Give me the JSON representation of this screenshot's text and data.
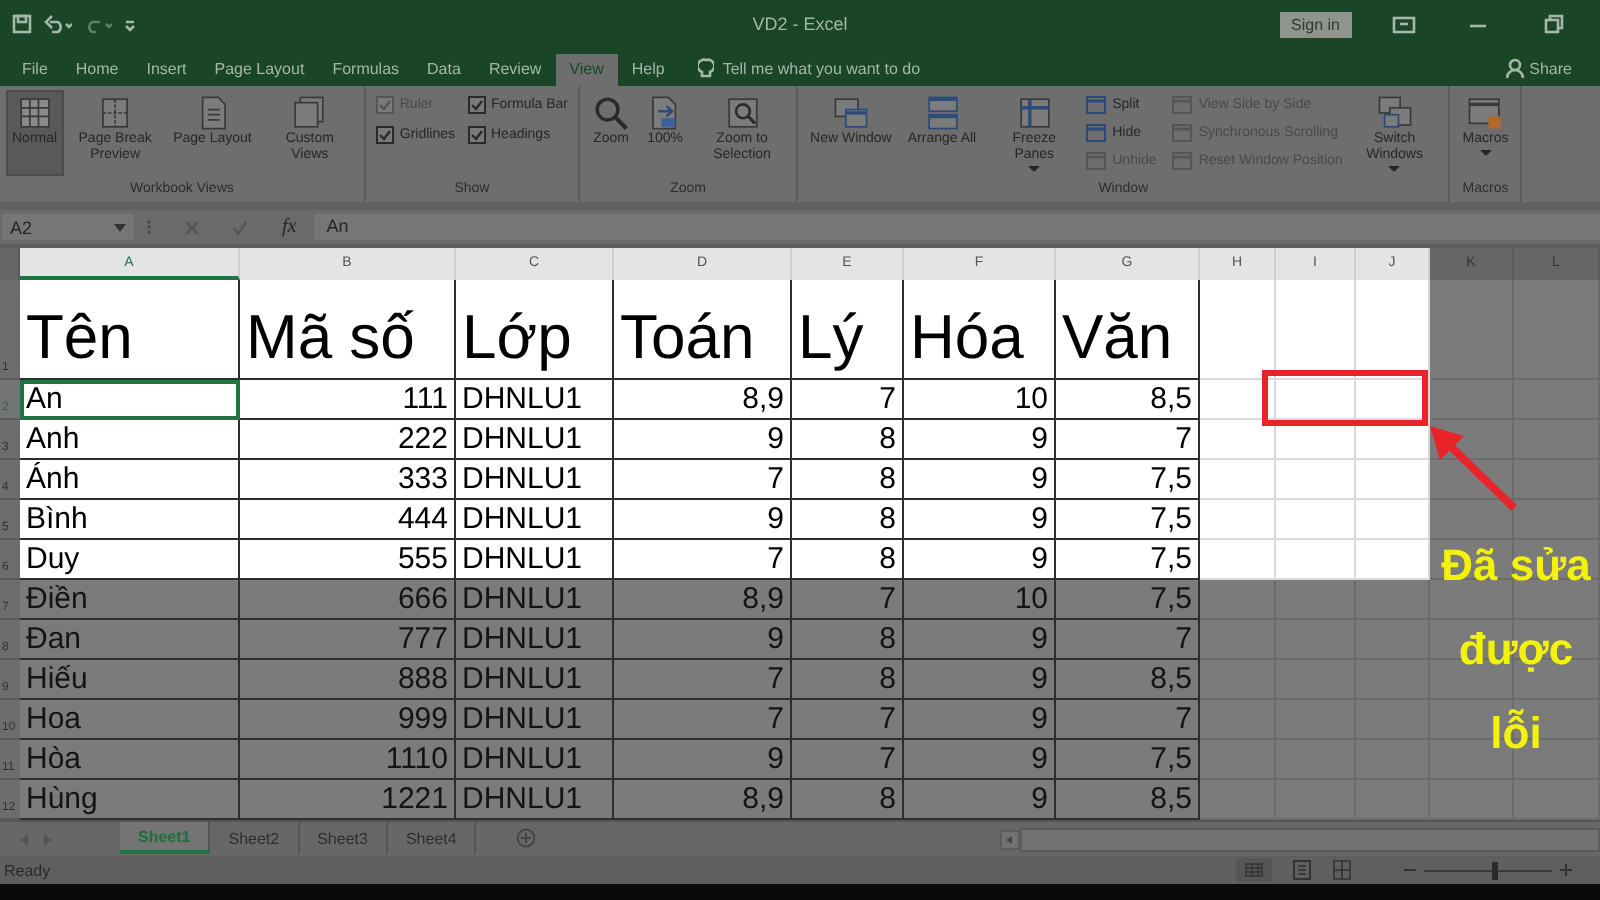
{
  "window": {
    "title": "VD2 - Excel",
    "sign_in": "Sign in"
  },
  "tabs": [
    {
      "label": "File",
      "selected": false
    },
    {
      "label": "Home",
      "selected": false
    },
    {
      "label": "Insert",
      "selected": false
    },
    {
      "label": "Page Layout",
      "selected": false
    },
    {
      "label": "Formulas",
      "selected": false
    },
    {
      "label": "Data",
      "selected": false
    },
    {
      "label": "Review",
      "selected": false
    },
    {
      "label": "View",
      "selected": true
    },
    {
      "label": "Help",
      "selected": false
    }
  ],
  "tell_me": {
    "placeholder": "Tell me what you want to do"
  },
  "share": "Share",
  "ribbon": {
    "groups": [
      {
        "label": "Workbook Views",
        "items": [
          {
            "kind": "large",
            "label": "Normal",
            "selected": true,
            "dropdown": false
          },
          {
            "kind": "large",
            "label": "Page Break Preview",
            "selected": false,
            "dropdown": false
          },
          {
            "kind": "large",
            "label": "Page Layout",
            "selected": false,
            "dropdown": false
          },
          {
            "kind": "large",
            "label": "Custom Views",
            "selected": false,
            "dropdown": false
          }
        ]
      },
      {
        "label": "Show",
        "items": [
          {
            "kind": "checkbox",
            "label": "Ruler",
            "checked": true,
            "disabled": true
          },
          {
            "kind": "checkbox",
            "label": "Formula Bar",
            "checked": true,
            "disabled": false
          },
          {
            "kind": "checkbox",
            "label": "Gridlines",
            "checked": true,
            "disabled": false
          },
          {
            "kind": "checkbox",
            "label": "Headings",
            "checked": true,
            "disabled": false
          }
        ]
      },
      {
        "label": "Zoom",
        "items": [
          {
            "kind": "large",
            "label": "Zoom",
            "dropdown": false
          },
          {
            "kind": "large",
            "label": "100%",
            "dropdown": false
          },
          {
            "kind": "large",
            "label": "Zoom to Selection",
            "dropdown": false
          }
        ]
      },
      {
        "label": "Window",
        "items": [
          {
            "kind": "large",
            "label": "New Window",
            "dropdown": false
          },
          {
            "kind": "large",
            "label": "Arrange All",
            "dropdown": false
          },
          {
            "kind": "large",
            "label": "Freeze Panes",
            "dropdown": true
          },
          {
            "kind": "small",
            "label": "Split",
            "disabled": false
          },
          {
            "kind": "small",
            "label": "Hide",
            "disabled": false
          },
          {
            "kind": "small",
            "label": "Unhide",
            "disabled": true
          },
          {
            "kind": "small",
            "label": "View Side by Side",
            "disabled": true
          },
          {
            "kind": "small",
            "label": "Synchronous Scrolling",
            "disabled": true
          },
          {
            "kind": "small",
            "label": "Reset Window Position",
            "disabled": true
          },
          {
            "kind": "large",
            "label": "Switch Windows",
            "dropdown": true
          }
        ]
      },
      {
        "label": "Macros",
        "items": [
          {
            "kind": "large",
            "label": "Macros",
            "dropdown": true
          }
        ]
      }
    ]
  },
  "formula_bar": {
    "name_box": "A2",
    "function_label": "fx",
    "value": "An"
  },
  "columns": [
    {
      "label": "A",
      "kind": "text",
      "selected": true,
      "highlighted": true
    },
    {
      "label": "B",
      "kind": "number",
      "selected": false,
      "highlighted": true
    },
    {
      "label": "C",
      "kind": "text",
      "selected": false,
      "highlighted": true
    },
    {
      "label": "D",
      "kind": "number",
      "selected": false,
      "highlighted": true
    },
    {
      "label": "E",
      "kind": "number",
      "selected": false,
      "highlighted": true
    },
    {
      "label": "F",
      "kind": "number",
      "selected": false,
      "highlighted": true
    },
    {
      "label": "G",
      "kind": "number",
      "selected": false,
      "highlighted": true
    },
    {
      "label": "H",
      "kind": "text",
      "selected": false,
      "highlighted": true
    },
    {
      "label": "I",
      "kind": "text",
      "selected": false,
      "highlighted": true
    },
    {
      "label": "J",
      "kind": "text",
      "selected": false,
      "highlighted": true
    },
    {
      "label": "K",
      "selected": false,
      "highlighted": false
    },
    {
      "label": "L",
      "selected": false,
      "highlighted": false
    }
  ],
  "rows": [
    {
      "label": "1",
      "kind": "header",
      "selected": false,
      "highlighted": true,
      "cells": [
        "Tên",
        "Mã số",
        "Lớp",
        "Toán",
        "Lý",
        "Hóa",
        "Văn"
      ]
    },
    {
      "label": "2",
      "kind": "data",
      "selected": true,
      "highlighted": true,
      "cells": [
        "An",
        "111",
        "DHNLU1",
        "8,9",
        "7",
        "10",
        "8,5"
      ]
    },
    {
      "label": "3",
      "kind": "data",
      "selected": false,
      "highlighted": true,
      "cells": [
        "Anh",
        "222",
        "DHNLU1",
        "9",
        "8",
        "9",
        "7"
      ]
    },
    {
      "label": "4",
      "kind": "data",
      "selected": false,
      "highlighted": true,
      "cells": [
        "Ánh",
        "333",
        "DHNLU1",
        "7",
        "8",
        "9",
        "7,5"
      ]
    },
    {
      "label": "5",
      "kind": "data",
      "selected": false,
      "highlighted": true,
      "cells": [
        "Bình",
        "444",
        "DHNLU1",
        "9",
        "8",
        "9",
        "7,5"
      ]
    },
    {
      "label": "6",
      "kind": "data",
      "selected": false,
      "highlighted": true,
      "cells": [
        "Duy",
        "555",
        "DHNLU1",
        "7",
        "8",
        "9",
        "7,5"
      ]
    },
    {
      "label": "7",
      "kind": "data",
      "selected": false,
      "highlighted": false,
      "cells": [
        "Điền",
        "666",
        "DHNLU1",
        "8,9",
        "7",
        "10",
        "7,5"
      ]
    },
    {
      "label": "8",
      "kind": "data",
      "selected": false,
      "highlighted": false,
      "cells": [
        "Đan",
        "777",
        "DHNLU1",
        "9",
        "8",
        "9",
        "7"
      ]
    },
    {
      "label": "9",
      "kind": "data",
      "selected": false,
      "highlighted": false,
      "cells": [
        "Hiếu",
        "888",
        "DHNLU1",
        "7",
        "8",
        "9",
        "8,5"
      ]
    },
    {
      "label": "10",
      "kind": "data",
      "selected": false,
      "highlighted": false,
      "cells": [
        "Hoa",
        "999",
        "DHNLU1",
        "7",
        "7",
        "9",
        "7"
      ]
    },
    {
      "label": "11",
      "kind": "data",
      "selected": false,
      "highlighted": false,
      "cells": [
        "Hòa",
        "1110",
        "DHNLU1",
        "9",
        "7",
        "9",
        "7,5"
      ]
    },
    {
      "label": "12",
      "kind": "data",
      "selected": false,
      "highlighted": false,
      "cells": [
        "Hùng",
        "1221",
        "DHNLU1",
        "8,9",
        "8",
        "9",
        "8,5"
      ]
    }
  ],
  "sheets": [
    {
      "label": "Sheet1",
      "selected": true
    },
    {
      "label": "Sheet2",
      "selected": false
    },
    {
      "label": "Sheet3",
      "selected": false
    },
    {
      "label": "Sheet4",
      "selected": false
    }
  ],
  "status_bar": {
    "text": "Ready",
    "zoom_slider": {
      "level": 0.55
    }
  },
  "annotation": {
    "text": "Đã sửa được lỗi"
  }
}
